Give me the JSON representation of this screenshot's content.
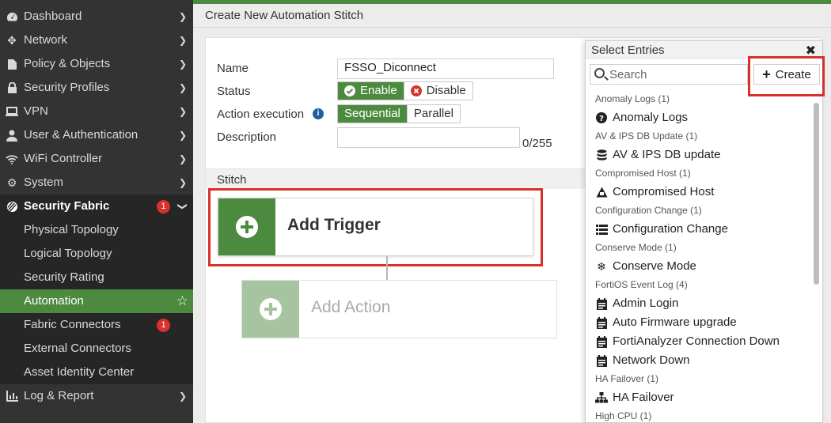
{
  "sidebar": {
    "items": [
      {
        "label": "Dashboard",
        "icon": "dashboard-icon"
      },
      {
        "label": "Network",
        "icon": "network-icon"
      },
      {
        "label": "Policy & Objects",
        "icon": "policy-icon"
      },
      {
        "label": "Security Profiles",
        "icon": "lock-icon"
      },
      {
        "label": "VPN",
        "icon": "vpn-icon"
      },
      {
        "label": "User & Authentication",
        "icon": "user-icon"
      },
      {
        "label": "WiFi Controller",
        "icon": "wifi-icon"
      },
      {
        "label": "System",
        "icon": "gear-icon"
      },
      {
        "label": "Security Fabric",
        "icon": "fabric-icon",
        "badge": "1"
      }
    ],
    "sub_items": [
      {
        "label": "Physical Topology"
      },
      {
        "label": "Logical Topology"
      },
      {
        "label": "Security Rating"
      },
      {
        "label": "Automation"
      },
      {
        "label": "Fabric Connectors",
        "badge": "1"
      },
      {
        "label": "External Connectors"
      },
      {
        "label": "Asset Identity Center"
      }
    ],
    "bottom_item": {
      "label": "Log & Report",
      "icon": "log-report-icon"
    }
  },
  "page": {
    "title": "Create New Automation Stitch"
  },
  "form": {
    "name_label": "Name",
    "name_value": "FSSO_Diconnect",
    "status_label": "Status",
    "status_enable": "Enable",
    "status_disable": "Disable",
    "action_execution_label": "Action execution",
    "exec_sequential": "Sequential",
    "exec_parallel": "Parallel",
    "description_label": "Description",
    "description_counter": "0/255"
  },
  "stitch": {
    "section_title": "Stitch",
    "add_trigger": "Add Trigger",
    "add_action": "Add Action"
  },
  "flyout": {
    "title": "Select Entries",
    "search_placeholder": "Search",
    "create_label": "Create",
    "groups": [
      {
        "title": "Anomaly Logs (1)",
        "entries": [
          {
            "label": "Anomaly Logs",
            "icon": "question-circle-icon"
          }
        ]
      },
      {
        "title": "AV & IPS DB Update (1)",
        "entries": [
          {
            "label": "AV & IPS DB update",
            "icon": "database-icon"
          }
        ]
      },
      {
        "title": "Compromised Host (1)",
        "entries": [
          {
            "label": "Compromised Host",
            "icon": "warning-host-icon"
          }
        ]
      },
      {
        "title": "Configuration Change (1)",
        "entries": [
          {
            "label": "Configuration Change",
            "icon": "list-icon"
          }
        ]
      },
      {
        "title": "Conserve Mode (1)",
        "entries": [
          {
            "label": "Conserve Mode",
            "icon": "snowflake-icon"
          }
        ]
      },
      {
        "title": "FortiOS Event Log (4)",
        "entries": [
          {
            "label": "Admin Login",
            "icon": "event-log-icon"
          },
          {
            "label": "Auto Firmware upgrade",
            "icon": "event-log-icon"
          },
          {
            "label": "FortiAnalyzer Connection Down",
            "icon": "event-log-icon"
          },
          {
            "label": "Network Down",
            "icon": "event-log-icon"
          }
        ]
      },
      {
        "title": "HA Failover (1)",
        "entries": [
          {
            "label": "HA Failover",
            "icon": "sitemap-icon"
          }
        ]
      },
      {
        "title": "High CPU (1)",
        "entries": []
      }
    ]
  },
  "colors": {
    "accent": "#4c8b3f",
    "highlight_box": "#d9302b",
    "sidebar_bg": "#333333"
  }
}
